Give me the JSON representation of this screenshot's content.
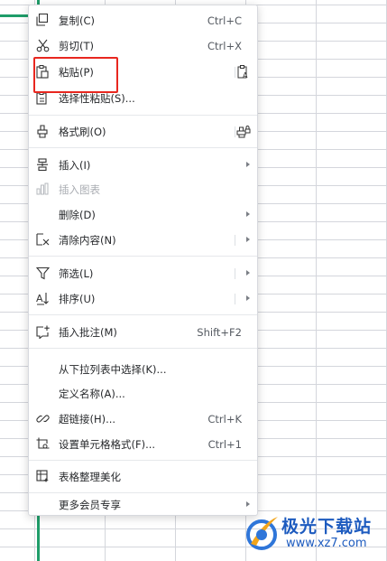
{
  "context_menu": {
    "items": [
      {
        "label": "复制(C)",
        "shortcut": "Ctrl+C",
        "icon": "copy-icon"
      },
      {
        "label": "剪切(T)",
        "shortcut": "Ctrl+X",
        "icon": "scissors-icon"
      },
      {
        "label": "粘贴(P)",
        "icon": "paste-icon",
        "right_icon": "paste-text-icon"
      },
      {
        "label": "选择性粘贴(S)...",
        "icon": "paste-special-icon"
      },
      {
        "label": "格式刷(O)",
        "icon": "format-painter-icon",
        "right_icon": "format-painter-lock-icon"
      },
      {
        "label": "插入(I)",
        "icon": "insert-icon",
        "submenu": true
      },
      {
        "label": "插入图表",
        "icon": "chart-icon",
        "disabled": true
      },
      {
        "label": "删除(D)",
        "submenu": true
      },
      {
        "label": "清除内容(N)",
        "icon": "clear-content-icon",
        "submenu": true
      },
      {
        "label": "筛选(L)",
        "icon": "filter-icon",
        "submenu": true
      },
      {
        "label": "排序(U)",
        "icon": "sort-icon",
        "submenu": true
      },
      {
        "label": "插入批注(M)",
        "shortcut": "Shift+F2",
        "icon": "comment-icon"
      },
      {
        "label": "从下拉列表中选择(K)..."
      },
      {
        "label": "定义名称(A)..."
      },
      {
        "label": "超链接(H)...",
        "shortcut": "Ctrl+K",
        "icon": "link-icon"
      },
      {
        "label": "设置单元格格式(F)...",
        "shortcut": "Ctrl+1",
        "icon": "cell-format-icon"
      },
      {
        "label": "表格整理美化",
        "icon": "table-beautify-icon"
      },
      {
        "label": "更多会员专享",
        "submenu": true
      }
    ]
  },
  "watermark": {
    "title": "极光下载站",
    "url": "www.xz7.com"
  },
  "colors": {
    "highlight": "#e8271f",
    "selection": "#1f9d69",
    "watermark": "#1d5bbf"
  }
}
